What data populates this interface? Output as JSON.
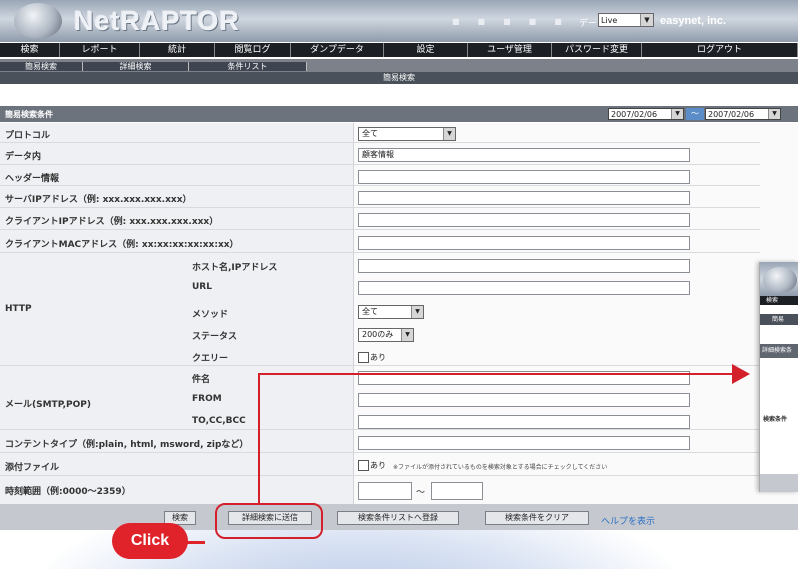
{
  "app": {
    "logo_text": "NetRAPTOR",
    "data_label": "データ",
    "data_source": "Live",
    "company": "easynet, inc."
  },
  "nav": {
    "items": [
      "検索",
      "レポート",
      "統計",
      "閲覧ログ",
      "ダンプデータ",
      "設定",
      "ユーザ管理",
      "パスワード変更",
      "ログアウト"
    ]
  },
  "subnav": {
    "tabs": [
      "簡易検索",
      "詳細検索",
      "条件リスト"
    ],
    "title": "簡易検索"
  },
  "date_bar": {
    "label": "簡易検索条件",
    "from": "2007/02/06",
    "separator": "～",
    "to": "2007/02/06"
  },
  "form": {
    "protocol": {
      "label": "プロトコル",
      "value": "全て"
    },
    "data_content": {
      "label": "データ内",
      "value": "顧客情報"
    },
    "header_info": {
      "label": "ヘッダー情報",
      "value": ""
    },
    "server_ip": {
      "label": "サーバIPアドレス（例: xxx.xxx.xxx.xxx）",
      "value": ""
    },
    "client_ip": {
      "label": "クライアントIPアドレス（例: xxx.xxx.xxx.xxx）",
      "value": ""
    },
    "client_mac": {
      "label": "クライアントMACアドレス（例: xx:xx:xx:xx:xx:xx）",
      "value": ""
    },
    "http": {
      "label": "HTTP",
      "host": {
        "label": "ホスト名,IPアドレス",
        "value": ""
      },
      "url": {
        "label": "URL",
        "value": ""
      },
      "method": {
        "label": "メソッド",
        "value": "全て"
      },
      "status": {
        "label": "ステータス",
        "value": "200のみ"
      },
      "query": {
        "label": "クエリー",
        "checkbox_label": "あり"
      }
    },
    "mail": {
      "label": "メール(SMTP,POP)",
      "subject": {
        "label": "件名",
        "value": ""
      },
      "from": {
        "label": "FROM",
        "value": ""
      },
      "to": {
        "label": "TO,CC,BCC",
        "value": ""
      }
    },
    "content_type": {
      "label": "コンテントタイプ（例:plain, html, msword, zipなど）",
      "value": ""
    },
    "attachment": {
      "label": "添付ファイル",
      "checkbox_label": "あり",
      "note": "※ファイルが添付されているものを検索対象とする場合にチェックしてください"
    },
    "time_range": {
      "label": "時刻範囲（例:0000～2359）",
      "from": "",
      "separator": "～",
      "to": ""
    }
  },
  "buttons": {
    "search": "検索",
    "send_detailed": "詳細検索に送信",
    "register_list": "検索条件リストへ登録",
    "clear": "検索条件をクリア",
    "help": "ヘルプを表示"
  },
  "annotation": {
    "click_label": "Click"
  },
  "thumbnail": {
    "nav_label": "検索",
    "sub_label": "簡易",
    "bar_label": "詳細検索条",
    "condition_label": "検索条件"
  },
  "colors": {
    "accent_red": "#d4202a",
    "nav_bg": "#1c1f24",
    "help_link": "#2b6fc4"
  }
}
